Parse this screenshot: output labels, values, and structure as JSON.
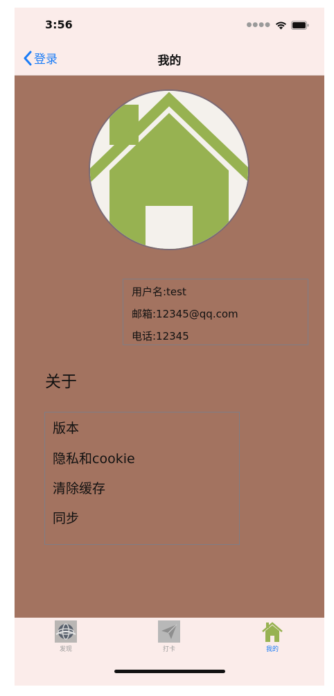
{
  "status_bar": {
    "time": "3:56",
    "signal_icon": "signal-dots-icon",
    "wifi_icon": "wifi-icon",
    "battery_icon": "battery-icon"
  },
  "nav": {
    "back_label": "登录",
    "back_icon": "chevron-left-icon",
    "title": "我的",
    "accent_color": "#1a7cf7"
  },
  "profile": {
    "avatar_icon": "house-icon",
    "username": "用户名:test",
    "email": "邮箱:12345@qq.com",
    "phone": "电话:12345"
  },
  "about": {
    "heading": "关于",
    "items": [
      {
        "label": "版本"
      },
      {
        "label": "隐私和cookie"
      },
      {
        "label": "清除缓存"
      },
      {
        "label": "同步"
      }
    ]
  },
  "tabs": [
    {
      "label": "发现",
      "icon": "globe-icon",
      "active": false
    },
    {
      "label": "打卡",
      "icon": "paper-plane-icon",
      "active": false
    },
    {
      "label": "我的",
      "icon": "house-icon",
      "active": true
    }
  ],
  "colors": {
    "content_background": "#a37360",
    "bar_background": "#fbecea",
    "active_tab": "#1a7cf7",
    "inactive_tab": "#9a9a9a"
  }
}
